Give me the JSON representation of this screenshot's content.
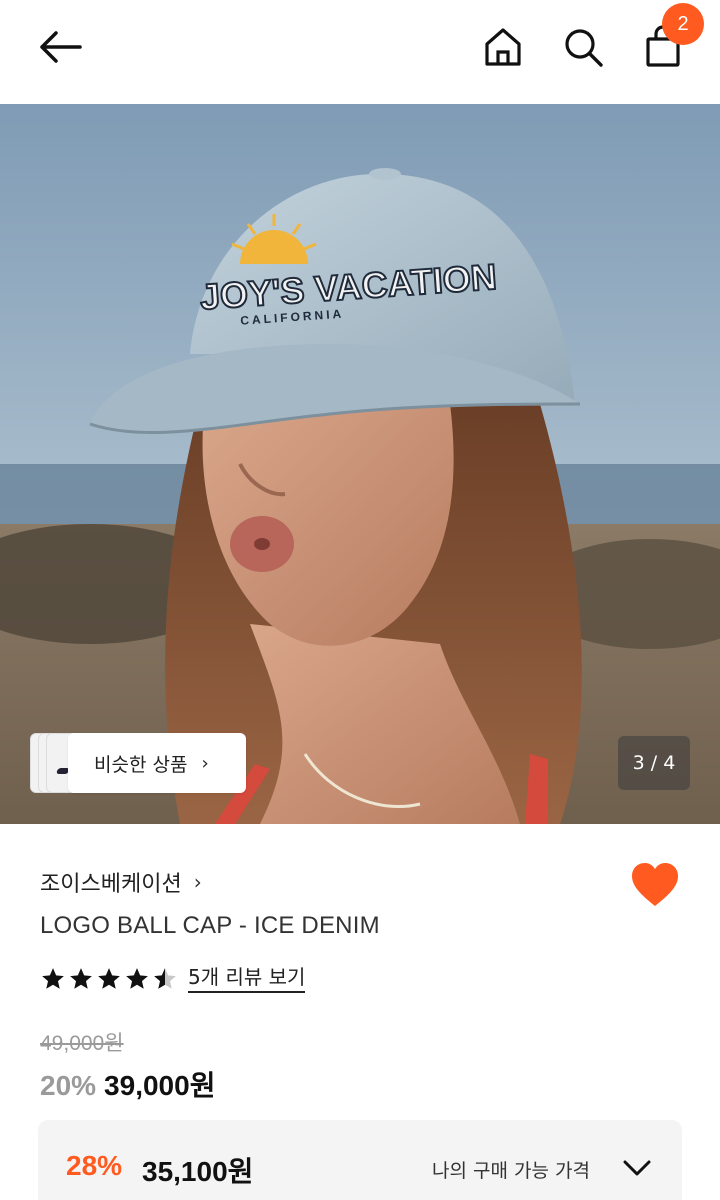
{
  "header": {
    "back_icon": "arrow-left-icon",
    "home_icon": "home-icon",
    "search_icon": "search-icon",
    "cart_icon": "shopping-bag-icon",
    "cart_badge": "2",
    "badge_color": "#ff5a1f"
  },
  "gallery": {
    "similar_label": "비슷한 상품",
    "page_indicator": "3 / 4",
    "current_page": 3,
    "total_pages": 4
  },
  "product": {
    "brand": "조이스베케이션",
    "name": "LOGO BALL CAP - ICE DENIM",
    "rating": 4.5,
    "rating_max": 5,
    "review_link": "5개 리뷰 보기",
    "original_price": "49,000원",
    "discount_percent": "20%",
    "sale_price": "39,000원",
    "wishlisted": true,
    "heart_color": "#ff5a1f"
  },
  "my_price": {
    "discount_percent": "28%",
    "price": "35,100원",
    "label": "나의 구매 가능 가격",
    "accent": "#ff5a1f"
  }
}
